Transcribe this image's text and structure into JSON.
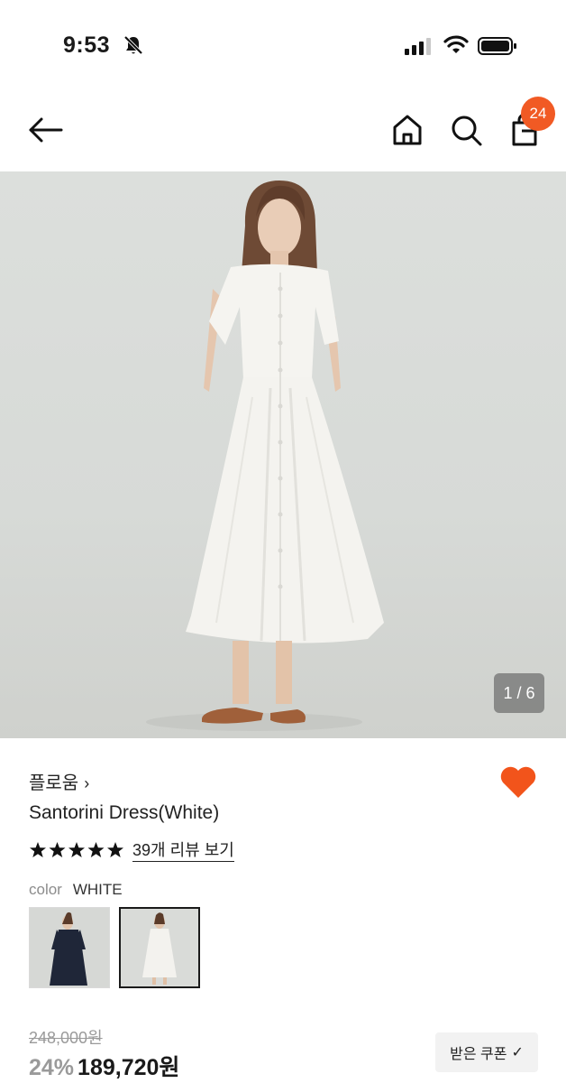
{
  "status_bar": {
    "time": "9:53"
  },
  "header": {
    "cart_count": "24"
  },
  "gallery": {
    "counter": "1 / 6"
  },
  "product": {
    "brand": "플로움",
    "name": "Santorini Dress(White)",
    "rating": 5,
    "review_link": "39개 리뷰 보기",
    "color_label": "color",
    "color_value": "WHITE",
    "swatches": [
      "navy",
      "white"
    ],
    "original_price": "248,000원",
    "discount": "24%",
    "sale_price": "189,720원",
    "coupon_label": "받은 쿠폰"
  },
  "colors": {
    "accent": "#f15a24",
    "badge": "#f15a24",
    "heart": "#f2541b"
  }
}
